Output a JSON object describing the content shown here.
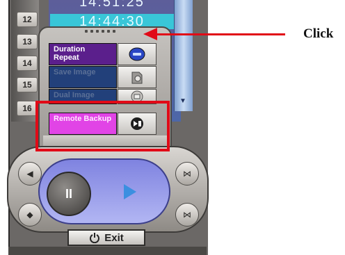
{
  "channels": [
    "12",
    "13",
    "14",
    "15",
    "16"
  ],
  "clock": {
    "top_time": "14:51:25",
    "second_time": "14:44:30"
  },
  "menu": {
    "duration_repeat_label": "Duration Repeat",
    "row2_label": "Save Image",
    "row3_label": "Dual Image",
    "remote_backup_label": "Remote Backup"
  },
  "controls": {
    "pause_glyph": "II",
    "exit_label": "Exit"
  },
  "annotation": {
    "click_label": "Click"
  },
  "colors": {
    "highlight": "#e10a17",
    "duration_repeat": "#5b1f8c",
    "remote_backup": "#e144e6",
    "play_arrow": "#3b8fe0"
  },
  "icons": [
    "minimize-icon",
    "save-icon",
    "dual-icon",
    "backup-icon",
    "rewind-icon",
    "fast-forward-icon",
    "prev-icon",
    "next-icon",
    "power-icon"
  ]
}
